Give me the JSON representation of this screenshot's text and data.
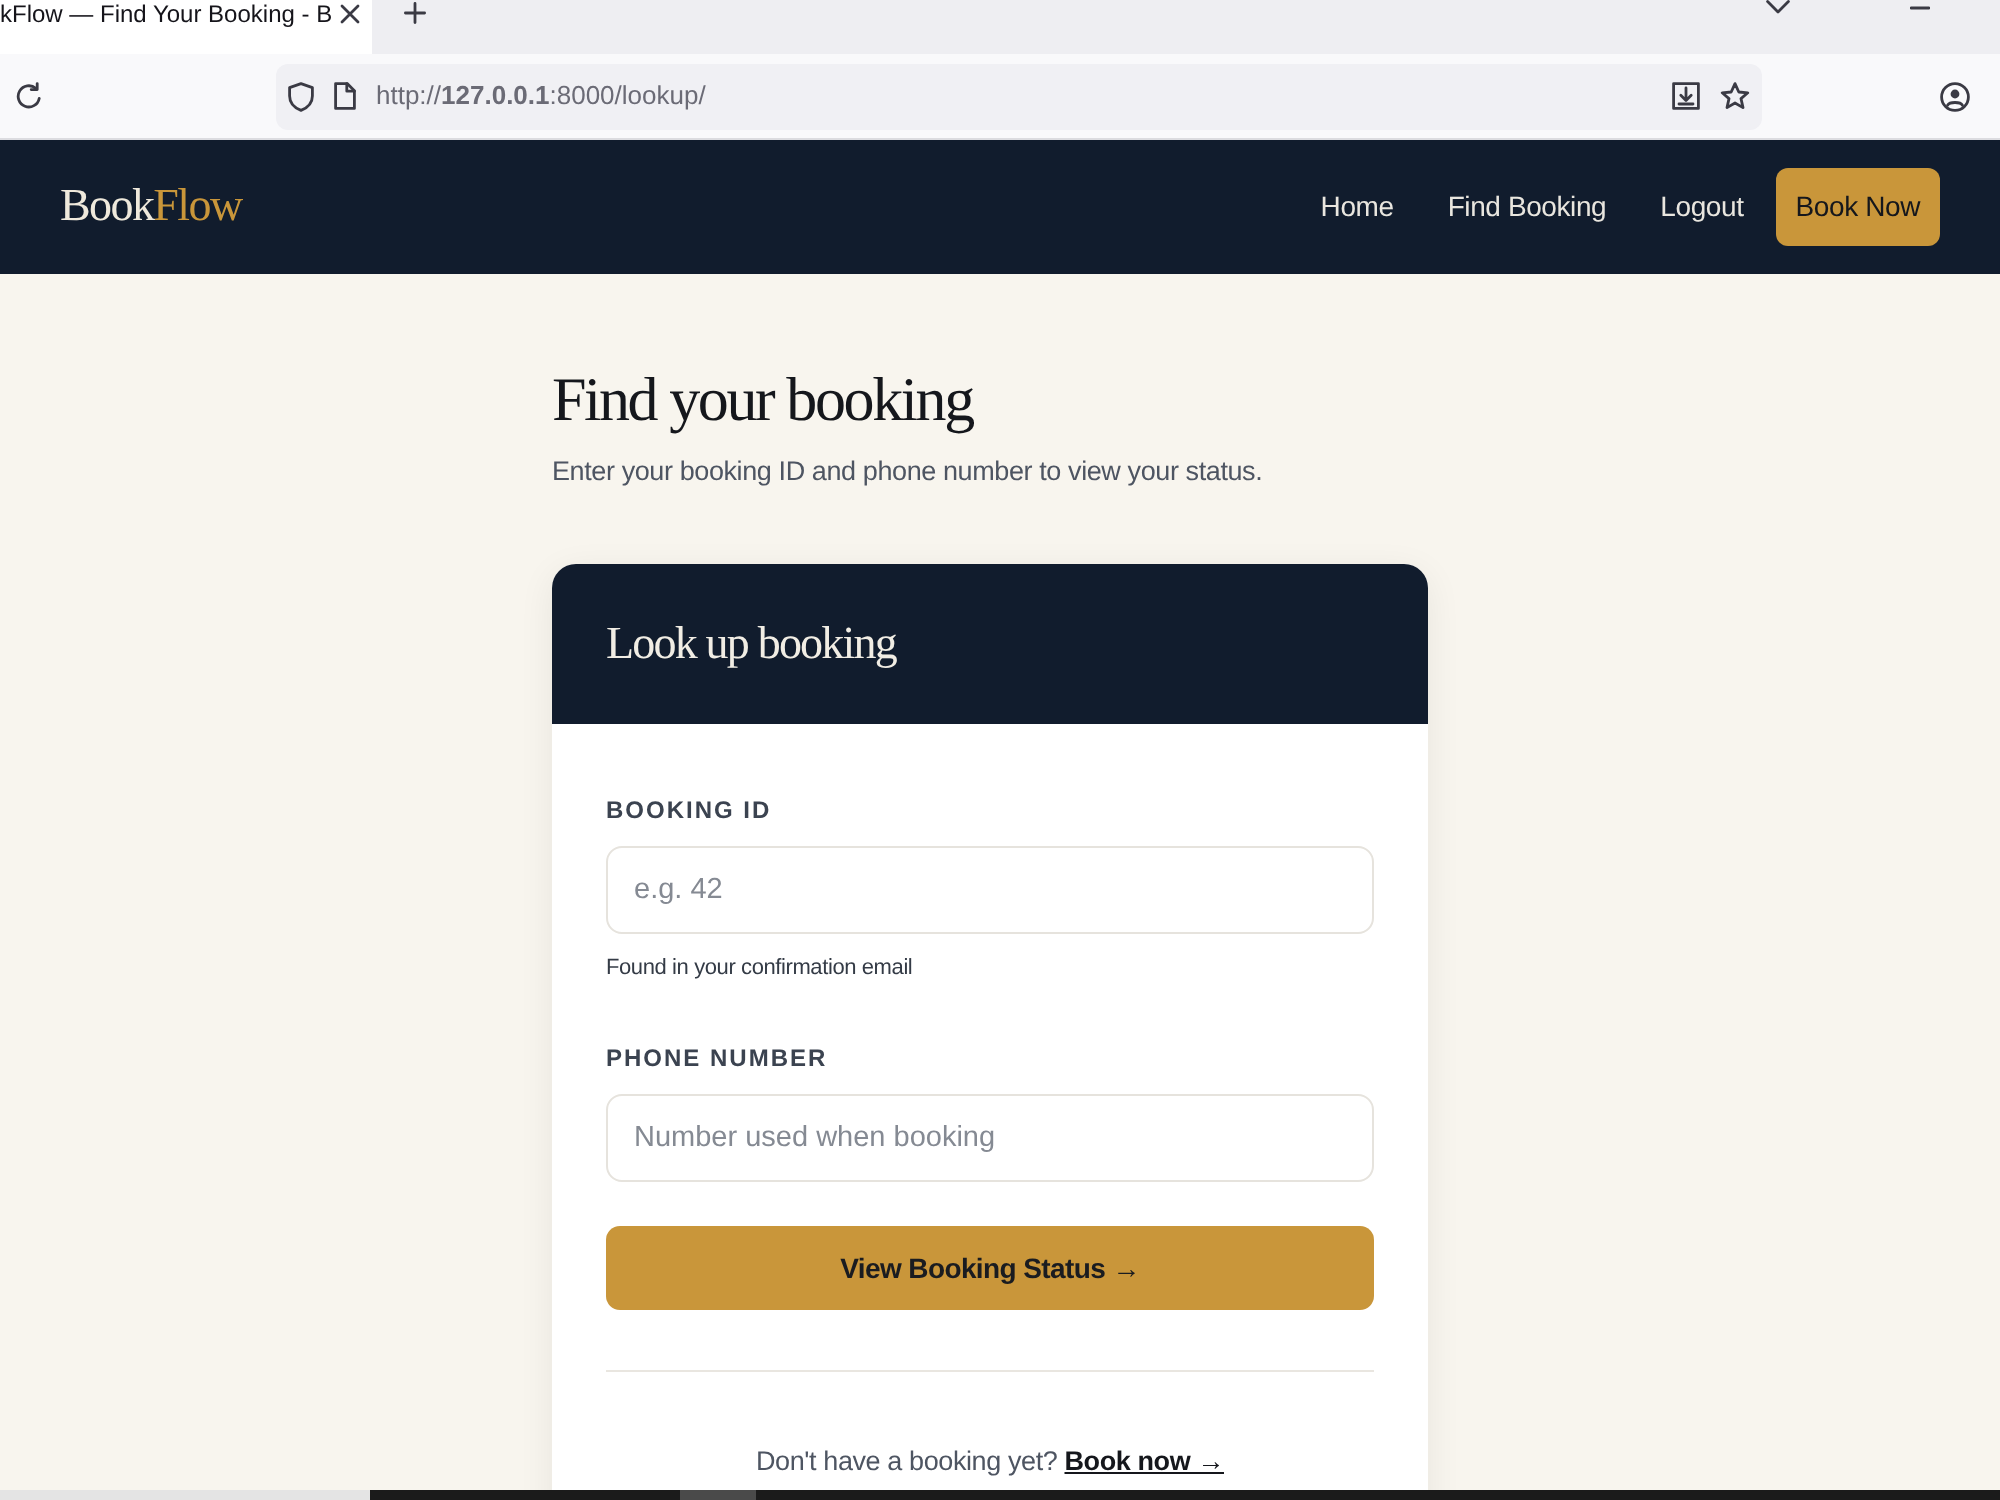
{
  "browser": {
    "tab": {
      "title": "kFlow — Find Your Booking - B"
    },
    "address": "http://**127.0.0.1**:8000/lookup/"
  },
  "navbar": {
    "brand": {
      "text": "Book",
      "accent": "Flow"
    },
    "links": [
      {
        "label": "Home",
        "kind": "link"
      },
      {
        "label": "Find Booking",
        "kind": "link"
      },
      {
        "label": "Logout",
        "kind": "link"
      },
      {
        "label": "Book Now",
        "kind": "button"
      }
    ]
  },
  "page": {
    "title": "Find your booking",
    "subtitle": "Enter your booking ID and phone number to view your status."
  },
  "card": {
    "title": "Look up booking",
    "fields": [
      {
        "label": "BOOKING ID",
        "placeholder": "e.g. 42",
        "help": "Found in your confirmation email"
      },
      {
        "label": "PHONE NUMBER",
        "placeholder": "Number used when booking"
      }
    ],
    "submit": "View Booking Status →",
    "footer": {
      "text": "Don't have a booking yet?",
      "link": "Book now →"
    }
  }
}
